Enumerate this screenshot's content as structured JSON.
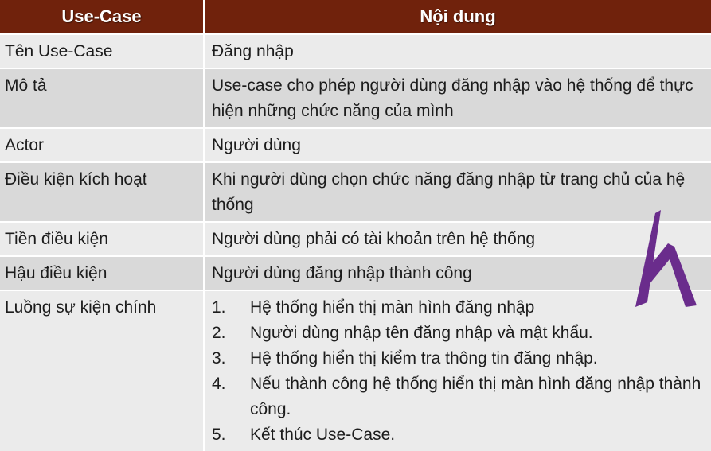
{
  "header": {
    "col1": "Use-Case",
    "col2": "Nội dung"
  },
  "rows": [
    {
      "label": "Tên Use-Case",
      "value": "Đăng nhập"
    },
    {
      "label": "Mô tả",
      "value": "Use-case cho phép người dùng đăng nhập vào hệ thống để thực hiện những chức năng của mình"
    },
    {
      "label": "Actor",
      "value": "Người dùng"
    },
    {
      "label": "Điều kiện kích hoạt",
      "value": "Khi người dùng chọn chức năng đăng nhập từ trang chủ của hệ thống"
    },
    {
      "label": "Tiền điều kiện",
      "value": "Người dùng phải có tài khoản trên hệ thống"
    },
    {
      "label": "Hậu điều kiện",
      "value": "Người dùng đăng nhập thành công"
    },
    {
      "label": "Luồng sự kiện chính"
    }
  ],
  "flow_steps": [
    {
      "num": "1.",
      "text": "Hệ thống hiển thị màn hình đăng nhập"
    },
    {
      "num": "2.",
      "text": "Người dùng nhập tên đăng nhập và mật khẩu."
    },
    {
      "num": "3.",
      "text": "Hệ thống hiển thị kiểm tra thông tin đăng nhập."
    },
    {
      "num": "4.",
      "text": "Nếu thành công hệ thống hiển thị màn hình đăng nhập thành công."
    },
    {
      "num": "5.",
      "text": "Kết thúc Use-Case."
    }
  ],
  "colors": {
    "header_bg": "#70220c",
    "row_odd": "#ebebeb",
    "row_even": "#d9d9d9",
    "logo": "#6a2c8c"
  },
  "icons": {
    "logo": "purple-h-logo-mark"
  }
}
